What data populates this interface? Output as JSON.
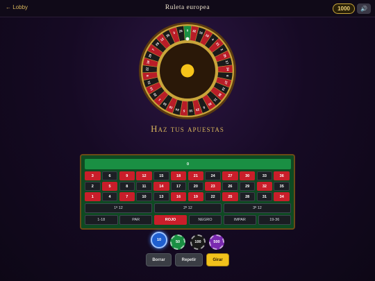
{
  "header": {
    "back_label": "← Lobby",
    "title": "Ruleta europea",
    "balance": "1000",
    "sound_icon": "🔊"
  },
  "wheel": {
    "sequence": [
      "0",
      "32",
      "15",
      "19",
      "4",
      "21",
      "2",
      "25",
      "17",
      "34",
      "6",
      "27",
      "13",
      "36",
      "11",
      "30",
      "8",
      "23",
      "10",
      "5",
      "24",
      "16",
      "33",
      "1",
      "20",
      "14",
      "31",
      "9",
      "22",
      "18",
      "29",
      "7",
      "28",
      "12",
      "35",
      "3",
      "26"
    ],
    "reds": [
      "1",
      "3",
      "5",
      "7",
      "9",
      "12",
      "14",
      "16",
      "18",
      "19",
      "21",
      "23",
      "25",
      "27",
      "30",
      "32",
      "34",
      "36"
    ],
    "colors": {
      "red": "#b81d28",
      "black": "#1a1a1a",
      "green": "#1a8f43",
      "gold": "#c9a53a",
      "hub": "#f5c31a"
    }
  },
  "bets_title": "Haz tus apuestas",
  "board": {
    "zero": "0",
    "rows": [
      [
        "3",
        "6",
        "9",
        "12",
        "15",
        "18",
        "21",
        "24",
        "27",
        "30",
        "33",
        "36"
      ],
      [
        "2",
        "5",
        "8",
        "11",
        "14",
        "17",
        "20",
        "23",
        "26",
        "29",
        "32",
        "35"
      ],
      [
        "1",
        "4",
        "7",
        "10",
        "13",
        "16",
        "19",
        "22",
        "25",
        "28",
        "31",
        "34"
      ]
    ],
    "dozens": [
      "1ª 12",
      "2ª 12",
      "3ª 12"
    ],
    "outside": [
      "1-18",
      "PAR",
      "ROJO",
      "NEGRO",
      "IMPAR",
      "19-36"
    ]
  },
  "chips": [
    {
      "label": "10",
      "color": "#1f5fcf",
      "selected": true
    },
    {
      "label": "50",
      "color": "#1a8f43",
      "selected": false
    },
    {
      "label": "100",
      "color": "#1a1a1a",
      "selected": false
    },
    {
      "label": "500",
      "color": "#7a2ab0",
      "selected": false
    }
  ],
  "actions": {
    "clear": "Borrar",
    "repeat": "Repetir",
    "spin": "Girar"
  }
}
